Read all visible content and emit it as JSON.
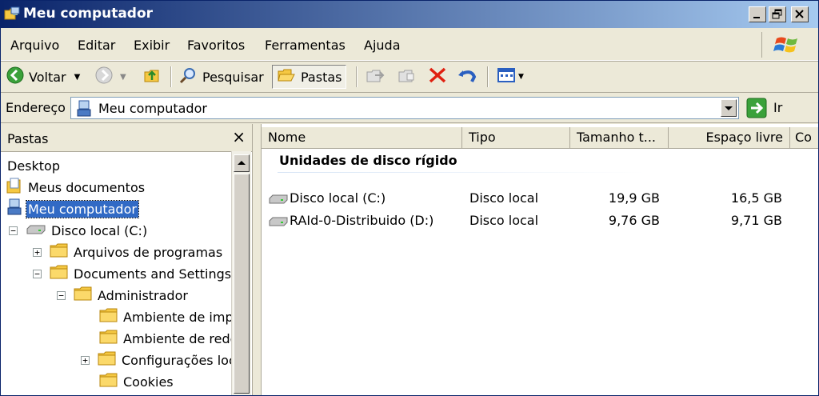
{
  "window": {
    "title": "Meu computador"
  },
  "menu": [
    "Arquivo",
    "Editar",
    "Exibir",
    "Favoritos",
    "Ferramentas",
    "Ajuda"
  ],
  "toolbar": {
    "back_label": "Voltar",
    "search_label": "Pesquisar",
    "folders_label": "Pastas"
  },
  "address": {
    "label": "Endereço",
    "value": "Meu computador",
    "go_label": "Ir"
  },
  "folders_pane": {
    "title": "Pastas",
    "close_glyph": "×",
    "items": [
      {
        "label": "Desktop",
        "icon": "none",
        "expander": ""
      },
      {
        "label": "Meus documentos",
        "icon": "my-documents-icon",
        "expander": ""
      },
      {
        "label": "Meu computador",
        "icon": "computer-icon",
        "expander": "",
        "selected": true
      },
      {
        "label": "Disco local (C:)",
        "icon": "drive-icon",
        "expander": "−"
      },
      {
        "label": "Arquivos de programas",
        "icon": "folder-icon",
        "expander": "+"
      },
      {
        "label": "Documents and Settings",
        "icon": "folder-icon",
        "expander": "−"
      },
      {
        "label": "Administrador",
        "icon": "folder-icon",
        "expander": "−"
      },
      {
        "label": "Ambiente de impr",
        "icon": "folder-icon",
        "expander": ""
      },
      {
        "label": "Ambiente de rede",
        "icon": "folder-icon",
        "expander": ""
      },
      {
        "label": "Configurações loc",
        "icon": "folder-icon",
        "expander": "+"
      },
      {
        "label": "Cookies",
        "icon": "folder-icon",
        "expander": ""
      }
    ]
  },
  "columns": [
    "Nome",
    "Tipo",
    "Tamanho t...",
    "Espaço livre",
    "Co"
  ],
  "group": {
    "title": "Unidades de disco rígido"
  },
  "drives": [
    {
      "name": "Disco local (C:)",
      "type": "Disco local",
      "total": "19,9 GB",
      "free": "16,5 GB"
    },
    {
      "name": "RAId-0-Distribuido (D:)",
      "type": "Disco local",
      "total": "9,76 GB",
      "free": "9,71 GB"
    }
  ],
  "colors": {
    "title_start": "#0a246a",
    "title_end": "#a6caf0",
    "selection": "#316ac5",
    "chrome": "#ece9d8"
  }
}
